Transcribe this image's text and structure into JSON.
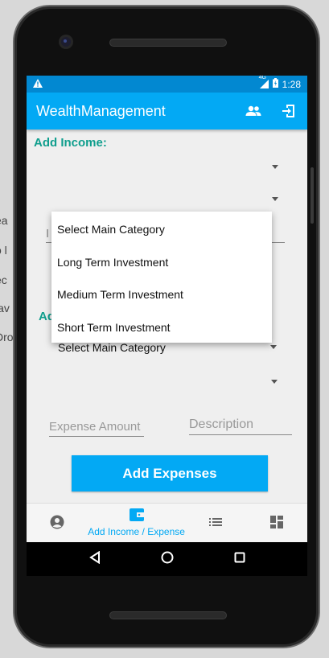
{
  "background_fragments": [
    "ea",
    "o l",
    "ec",
    "lav",
    "Dro"
  ],
  "status": {
    "network": "4G",
    "time": "1:28"
  },
  "appbar": {
    "title": "WealthManagement"
  },
  "income": {
    "title": "Add Income:",
    "amount_hint": "I",
    "dropdown_items": [
      "Select Main Category",
      "Long Term Investment",
      "Medium Term Investment",
      "Short Term Investment"
    ]
  },
  "expense": {
    "title": "Add Expense:",
    "main_category": "Select Main Category",
    "amount_placeholder": "Expense Amount",
    "description_placeholder": "Description",
    "button_label": "Add Expenses"
  },
  "bottom_nav": {
    "active_label": "Add Income / Expense"
  },
  "colors": {
    "primary": "#03a9f4",
    "status_bar": "#0288d1",
    "accent_title": "#0f9e8d"
  }
}
